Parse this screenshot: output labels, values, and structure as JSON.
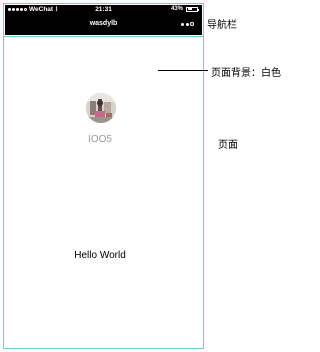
{
  "status_bar": {
    "carrier": "WeChat",
    "time": "21:31",
    "battery": "43%",
    "signal_icon": "signal-dots-icon",
    "wifi_icon": "wifi-icon",
    "battery_icon": "battery-icon"
  },
  "navbar": {
    "title": "wasdylb",
    "more_icon": "more-dots-icon",
    "background": "#000000"
  },
  "page": {
    "avatar": "user-avatar",
    "nickname": "IOO5",
    "greeting": "Hello World",
    "background": "#ffffff"
  },
  "annotations": {
    "navbar_label": "导航栏",
    "background_label": "页面背景：白色",
    "page_label": "页面"
  },
  "colors": {
    "frame_border": "#6ecfc4",
    "nickname_text": "#9a9a9a"
  }
}
